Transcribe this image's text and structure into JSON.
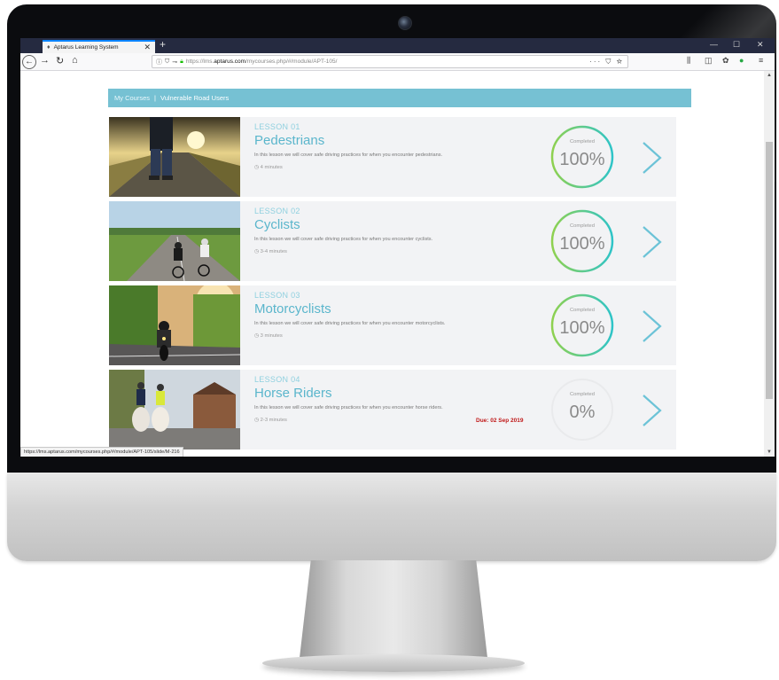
{
  "browser": {
    "tab_title": "Aptarus Learning System",
    "tab_close": "✕",
    "new_tab": "+",
    "url_prefix": "https://lms.",
    "url_host": "aptarus.com",
    "url_path": "/mycourses.php/#/module/APT-105/",
    "url_actions": "··· ⛉ ☆",
    "status_url": "https://lms.aptarus.com/mycourses.php/#/module/APT-105/slide/M-216"
  },
  "breadcrumb": {
    "root": "My Courses",
    "separator": "|",
    "current": "Vulnerable Road Users"
  },
  "lessons": [
    {
      "number": "LESSON 01",
      "title": "Pedestrians",
      "description": "In this lesson we will cover safe driving practices for when you encounter pedestrians.",
      "duration": "4 minutes",
      "status_label": "Completed",
      "progress_text": "100%",
      "progress": 1.0,
      "due": ""
    },
    {
      "number": "LESSON 02",
      "title": "Cyclists",
      "description": "In this lesson we will cover safe driving practices for when you encounter cyclists.",
      "duration": "3-4 minutes",
      "status_label": "Completed",
      "progress_text": "100%",
      "progress": 1.0,
      "due": ""
    },
    {
      "number": "LESSON 03",
      "title": "Motorcyclists",
      "description": "In this lesson we will cover safe driving practices for when you encounter motorcyclists.",
      "duration": "3 minutes",
      "status_label": "Completed",
      "progress_text": "100%",
      "progress": 1.0,
      "due": ""
    },
    {
      "number": "LESSON 04",
      "title": "Horse Riders",
      "description": "In this lesson we will cover safe driving practices for when you encounter horse riders.",
      "duration": "2-3 minutes",
      "status_label": "Completed",
      "progress_text": "0%",
      "progress": 0.0,
      "due": "Due: 02 Sep 2019"
    }
  ],
  "colors": {
    "accent": "#76c1d3",
    "title": "#5bb6cc",
    "due": "#c01818",
    "ring_start": "#8fd14f",
    "ring_end": "#2ec4c8"
  },
  "icons": {
    "clock": "clock-icon",
    "chevron": "chevron-right-icon",
    "lock": "lock-icon"
  }
}
